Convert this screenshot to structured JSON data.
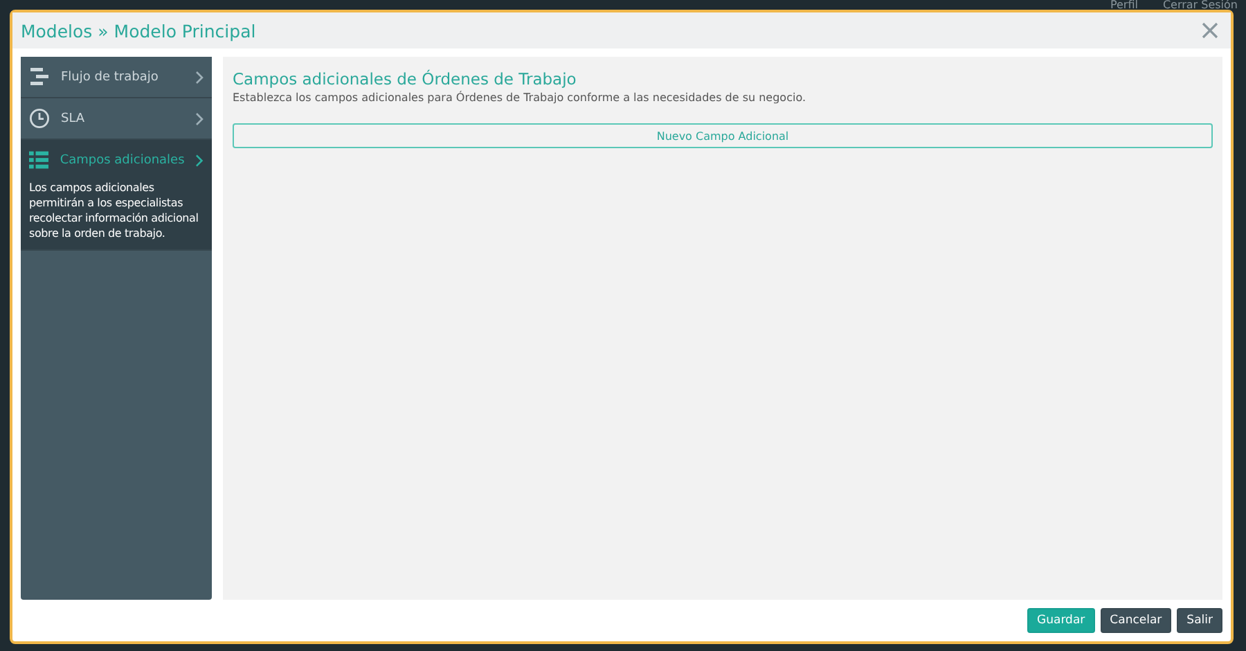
{
  "page_header": {
    "links": [
      "Perfil",
      "Cerrar Sesión"
    ]
  },
  "window": {
    "title": "Modelos » Modelo Principal"
  },
  "sidebar": {
    "items": [
      {
        "kind": "flow",
        "label": "Flujo de trabajo",
        "selected": false
      },
      {
        "kind": "clock",
        "label": "SLA",
        "selected": false
      },
      {
        "kind": "list",
        "label": "Campos adicionales",
        "selected": true,
        "description": "Los campos adicionales permitirán a los especialistas recolectar información adicional sobre la orden de trabajo."
      }
    ]
  },
  "content": {
    "title": "Campos adicionales de Órdenes de Trabajo",
    "subtitle": "Establezca los campos adicionales para Órdenes de Trabajo conforme a las necesidades de su negocio.",
    "add_button": "Nuevo Campo Adicional"
  },
  "footer": {
    "buttons": [
      {
        "kind": "primary",
        "label": "Guardar"
      },
      {
        "kind": "secondary",
        "label": "Cancelar"
      },
      {
        "kind": "secondary",
        "label": "Salir"
      }
    ]
  }
}
